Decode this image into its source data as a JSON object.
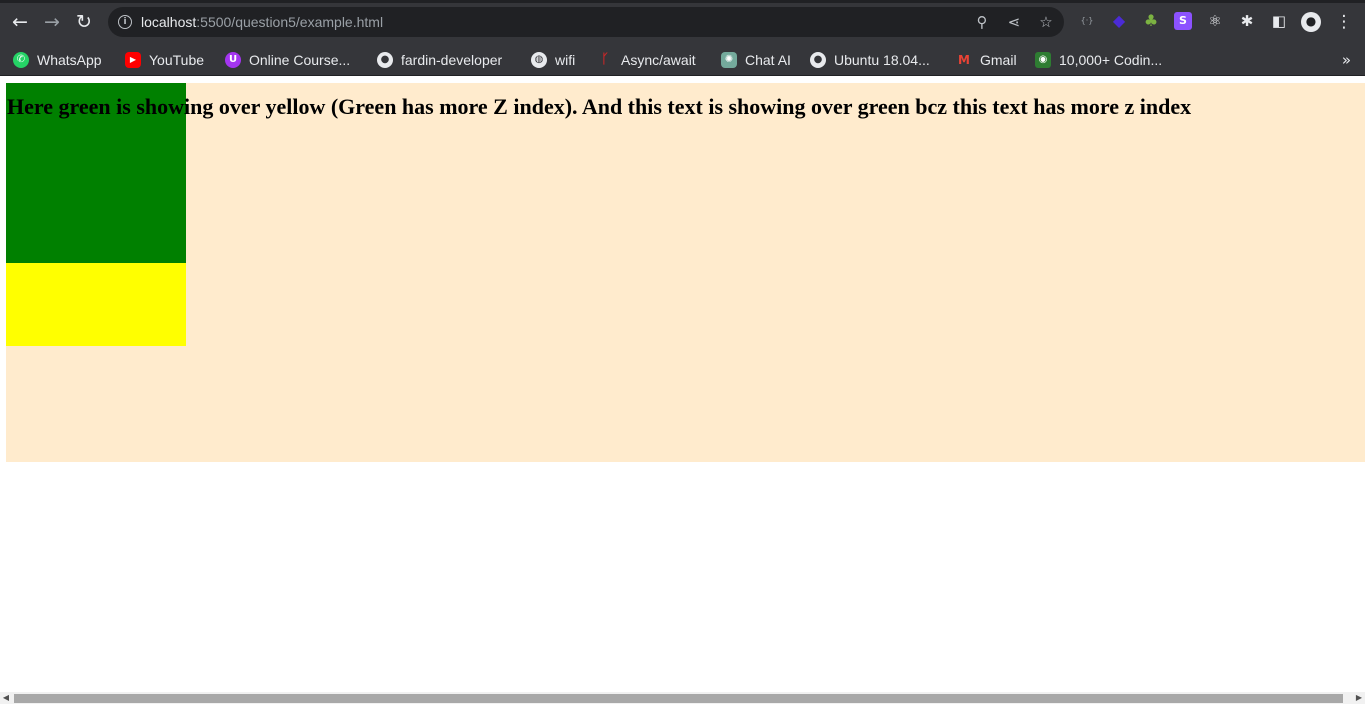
{
  "browser": {
    "url_host": "localhost",
    "url_rest": ":5500/question5/example.html",
    "nav": {
      "back": "←",
      "forward": "→",
      "reload": "↻"
    },
    "omnibox_actions": {
      "zoom": "⚲",
      "share": "⋖",
      "bookmark": "☆"
    },
    "extensions": [
      {
        "name": "extension-braces",
        "glyph": "{·}",
        "color": "#35363a"
      },
      {
        "name": "extension-cube",
        "glyph": "◆",
        "color": "#4b2bd6"
      },
      {
        "name": "extension-tree",
        "glyph": "♣",
        "color": "#2e7d32"
      },
      {
        "name": "extension-s",
        "glyph": "S",
        "color": "#8c52ff"
      },
      {
        "name": "extension-react",
        "glyph": "⚛",
        "color": "#35363a"
      },
      {
        "name": "extensions-puzzle",
        "glyph": "✱",
        "color": "#35363a"
      },
      {
        "name": "side-panel",
        "glyph": "◧",
        "color": "#35363a"
      }
    ],
    "menu": "⋮"
  },
  "bookmarks": [
    {
      "label": "WhatsApp",
      "icon": "whatsapp-icon",
      "glyph": "✆",
      "color": "#25d366"
    },
    {
      "label": "YouTube",
      "icon": "youtube-icon",
      "glyph": "▶",
      "color": "#ff0000"
    },
    {
      "label": "Online Course...",
      "icon": "course-icon",
      "glyph": "U",
      "color": "#a435f0"
    },
    {
      "label": "fardin-developer",
      "icon": "github-icon",
      "glyph": "●",
      "color": "#e8eaed"
    },
    {
      "label": "wifi",
      "icon": "globe-icon",
      "glyph": "◍",
      "color": "#e8eaed"
    },
    {
      "label": "Async/await",
      "icon": "async-icon",
      "glyph": "ᚴ",
      "color": "#c62828"
    },
    {
      "label": "Chat AI",
      "icon": "chatgpt-icon",
      "glyph": "✺",
      "color": "#74aa9c"
    },
    {
      "label": "Ubuntu 18.04...",
      "icon": "github-icon",
      "glyph": "●",
      "color": "#e8eaed"
    },
    {
      "label": "Gmail",
      "icon": "gmail-icon",
      "glyph": "M",
      "color": "#ea4335"
    },
    {
      "label": "10,000+ Codin...",
      "icon": "coding-icon",
      "glyph": "◉",
      "color": "#2e7d32"
    }
  ],
  "bookmarks_more": "»",
  "page": {
    "headline": "Here green is showing over yellow (Green has more Z index). And this text is showing over green bcz this text has more z index",
    "colors": {
      "container": "#ffebcd",
      "green_box": "#008000",
      "yellow_box": "#ffff00"
    }
  },
  "scrollbar": {
    "left_arrow": "◀",
    "right_arrow": "▶"
  }
}
